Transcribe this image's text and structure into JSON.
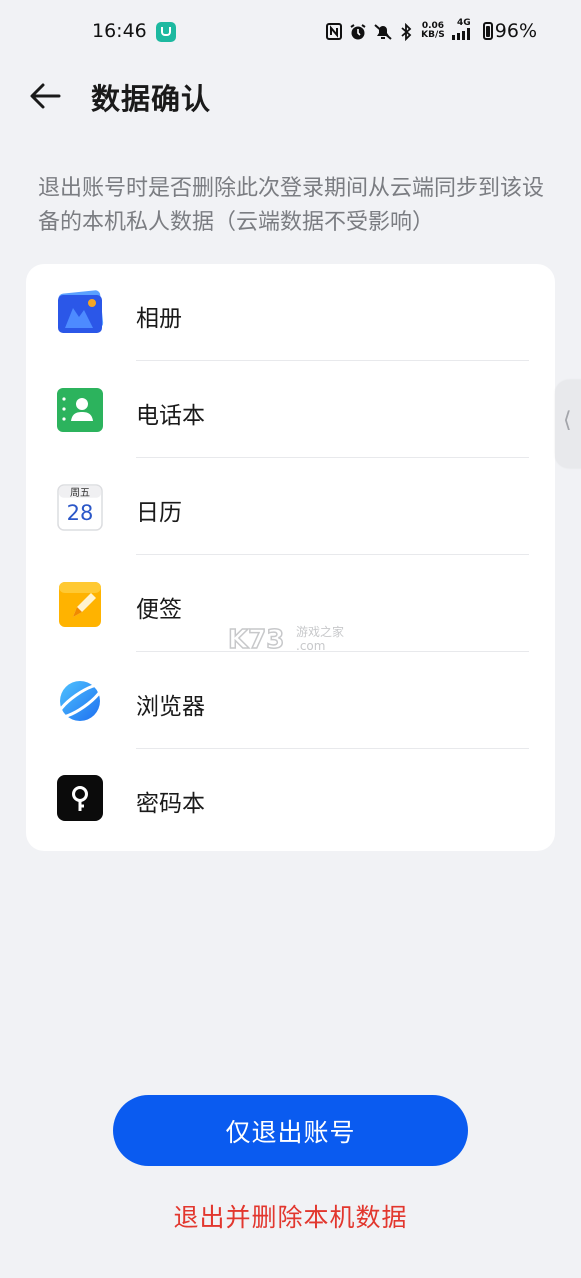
{
  "status_bar": {
    "time": "16:46",
    "network_speed_value": "0.06",
    "network_speed_unit": "KB/S",
    "network_type": "4G",
    "battery": "96%"
  },
  "header": {
    "title": "数据确认"
  },
  "description": "退出账号时是否删除此次登录期间从云端同步到该设备的本机私人数据（云端数据不受影响）",
  "data_items": [
    {
      "label": "相册",
      "icon": "gallery-icon"
    },
    {
      "label": "电话本",
      "icon": "contacts-icon"
    },
    {
      "label": "日历",
      "icon": "calendar-icon",
      "icon_text_day": "周五",
      "icon_text_date": "28"
    },
    {
      "label": "便签",
      "icon": "notes-icon"
    },
    {
      "label": "浏览器",
      "icon": "browser-icon"
    },
    {
      "label": "密码本",
      "icon": "password-vault-icon"
    }
  ],
  "watermark": {
    "text_main": "K73",
    "text_cn": "游戏之家",
    "text_domain": ".com"
  },
  "actions": {
    "primary_label": "仅退出账号",
    "danger_label": "退出并删除本机数据"
  },
  "colors": {
    "primary": "#0a5bf0",
    "danger": "#e2372e",
    "background": "#f1f2f5"
  }
}
